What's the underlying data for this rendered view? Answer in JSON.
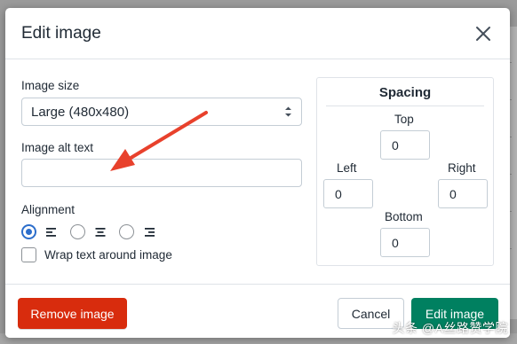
{
  "dialog": {
    "title": "Edit image",
    "close_icon": "close-icon"
  },
  "image_size": {
    "label": "Image size",
    "selected": "Large (480x480)"
  },
  "alt_text": {
    "label": "Image alt text",
    "value": ""
  },
  "alignment": {
    "label": "Alignment",
    "options": [
      {
        "icon": "align-left-icon",
        "checked": true
      },
      {
        "icon": "align-center-icon",
        "checked": false
      },
      {
        "icon": "align-right-icon",
        "checked": false
      }
    ]
  },
  "wrap": {
    "label": "Wrap text around image",
    "checked": false
  },
  "spacing": {
    "title": "Spacing",
    "top_label": "Top",
    "top_value": "0",
    "left_label": "Left",
    "left_value": "0",
    "right_label": "Right",
    "right_value": "0",
    "bottom_label": "Bottom",
    "bottom_value": "0"
  },
  "footer": {
    "remove_label": "Remove image",
    "cancel_label": "Cancel",
    "edit_label": "Edit image"
  },
  "annotation": {
    "arrow_color": "#e8412c"
  },
  "colors": {
    "danger": "#d82c0d",
    "primary": "#008060",
    "radio_accent": "#2c6ecb"
  },
  "watermark": "头条 @A丝路赞学院"
}
